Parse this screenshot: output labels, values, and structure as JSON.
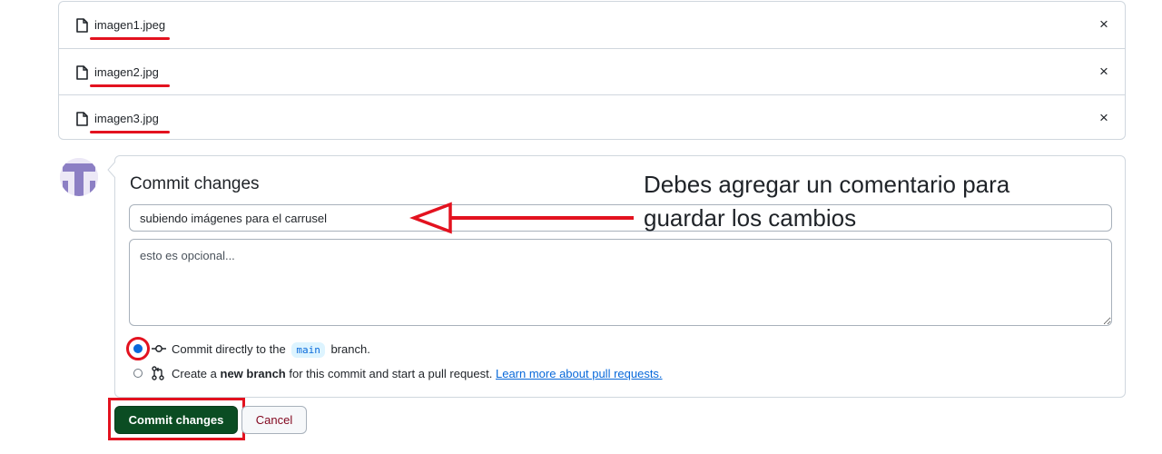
{
  "files": [
    {
      "name": "imagen1.jpeg",
      "icon": "file-icon",
      "remove_icon": "×"
    },
    {
      "name": "imagen2.jpg",
      "icon": "file-icon",
      "remove_icon": "×"
    },
    {
      "name": "imagen3.jpg",
      "icon": "file-icon",
      "remove_icon": "×"
    }
  ],
  "commit": {
    "title": "Commit changes",
    "summary_value": "subiendo imágenes para el carrusel",
    "description_placeholder": "esto es opcional...",
    "option_direct": {
      "prefix": "Commit directly to the",
      "branch": "main",
      "suffix": "branch.",
      "checked": true
    },
    "option_new_branch": {
      "prefix": "Create a",
      "bold": "new branch",
      "suffix": "for this commit and start a pull request.",
      "link": "Learn more about pull requests.",
      "checked": false
    },
    "submit_label": "Commit changes",
    "cancel_label": "Cancel"
  },
  "annotation": {
    "line1": "Debes agregar un comentario para",
    "line2": "guardar los cambios",
    "color": "#e3121f"
  },
  "colors": {
    "primary_button": "#0b4d23",
    "accent": "#0969da",
    "danger_text": "#82071e",
    "highlight": "#e3121f"
  }
}
